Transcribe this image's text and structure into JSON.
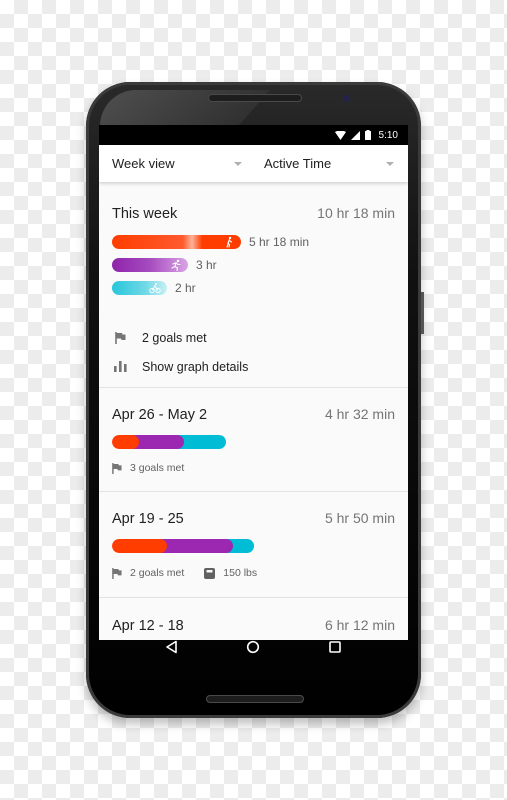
{
  "status_bar": {
    "time": "5:10",
    "icons": [
      "wifi-icon",
      "cell-signal-icon",
      "battery-icon"
    ]
  },
  "header": {
    "view_dropdown": {
      "selected": "Week view"
    },
    "metric_dropdown": {
      "selected": "Active Time"
    }
  },
  "this_week": {
    "title": "This week",
    "total": "10 hr 18 min",
    "activities": [
      {
        "activity": "walking",
        "icon": "walking-icon",
        "label": "5 hr 18 min",
        "minutes": 318,
        "color": "#ff3d00"
      },
      {
        "activity": "running",
        "icon": "running-icon",
        "label": "3 hr",
        "minutes": 180,
        "color": "#9c27b0"
      },
      {
        "activity": "cycling",
        "icon": "cycling-icon",
        "label": "2 hr",
        "minutes": 120,
        "color": "#26c6da"
      }
    ],
    "goals_met": "2 goals met",
    "graph_details_link": "Show graph details"
  },
  "weeks": [
    {
      "range": "Apr 26 - May 2",
      "total": "4 hr 32 min",
      "segments": [
        {
          "activity": "walking",
          "share": 0.24,
          "color": "#ff3d00"
        },
        {
          "activity": "running",
          "share": 0.32,
          "color": "#9c27b0"
        },
        {
          "activity": "cycling",
          "share": 0.44,
          "color": "#00bcd4"
        }
      ],
      "goals_met": "3 goals met",
      "weight": null
    },
    {
      "range": "Apr 19 - 25",
      "total": "5 hr 50 min",
      "segments": [
        {
          "activity": "walking",
          "share": 0.38,
          "color": "#ff3d00"
        },
        {
          "activity": "running",
          "share": 0.45,
          "color": "#9c27b0"
        },
        {
          "activity": "cycling",
          "share": 0.17,
          "color": "#00bcd4"
        }
      ],
      "goals_met": "2 goals met",
      "weight": "150 lbs"
    },
    {
      "range": "Apr 12 - 18",
      "total": "6 hr 12 min"
    }
  ],
  "nav_bar": {
    "buttons": [
      "back",
      "home",
      "recents"
    ]
  }
}
